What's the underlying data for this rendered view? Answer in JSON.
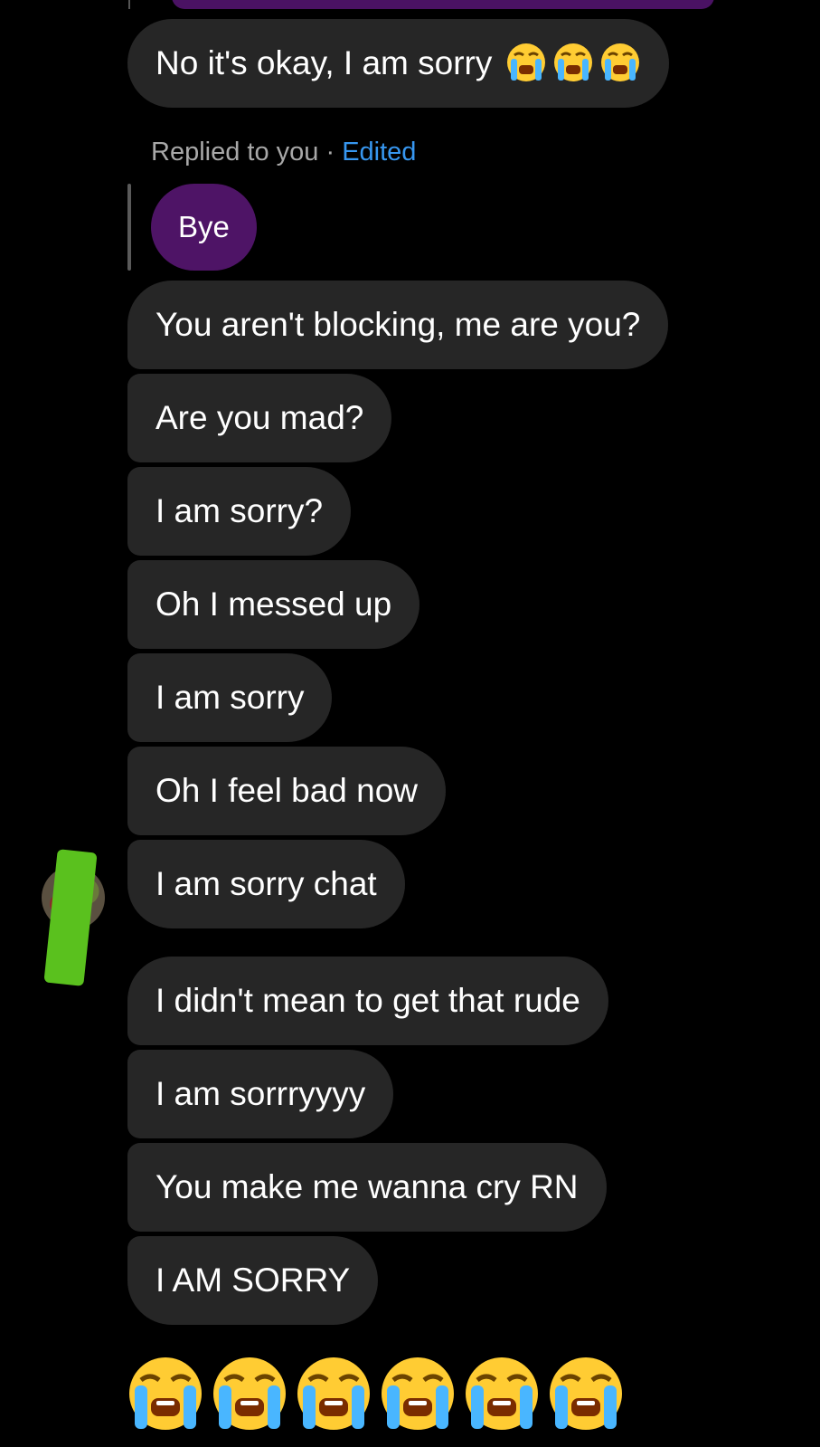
{
  "conversation": {
    "messages": [
      {
        "text": "No it's okay, I am sorry",
        "emoji_count": 3
      },
      {
        "text": "You aren't blocking, me are you?"
      },
      {
        "text": "Are you mad?"
      },
      {
        "text": "I am sorry?"
      },
      {
        "text": "Oh I messed up"
      },
      {
        "text": "I am sorry"
      },
      {
        "text": "Oh I feel bad now"
      },
      {
        "text": "I am sorry chat"
      },
      {
        "text": "I didn't mean to get that rude"
      },
      {
        "text": "I am sorrryyyy"
      },
      {
        "text": "You make me wanna cry RN"
      },
      {
        "text": "I AM SORRY"
      }
    ],
    "reply": {
      "label": "Replied to you",
      "separator": " · ",
      "edited": "Edited",
      "quoted_text": "Bye"
    },
    "emoji_message": {
      "emoji": "loudly-crying-face",
      "count": 6
    }
  },
  "colors": {
    "background": "#000000",
    "received_bubble": "#262626",
    "sent_bubble": "#4e1466",
    "edited_link": "#3797f0",
    "meta_text": "#a8a8a8"
  }
}
